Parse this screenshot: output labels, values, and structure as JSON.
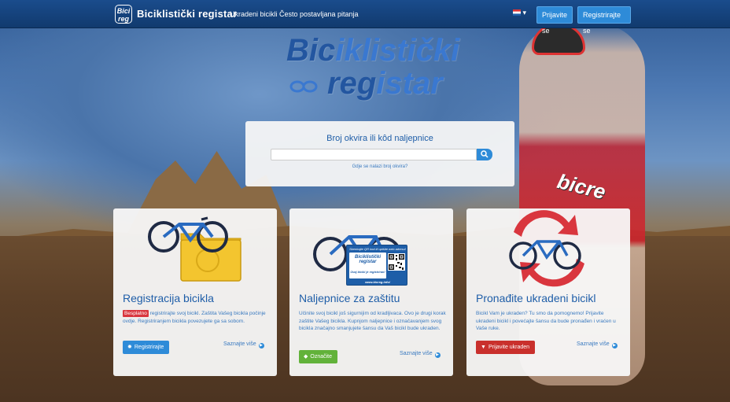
{
  "navbar": {
    "logo_text": "Bici reg",
    "brand": "Biciklistički registar",
    "links": [
      "Ukradeni bicikli",
      "Često postavljana pitanja"
    ],
    "language_selector": "▾",
    "login_label": "Prijavite se",
    "register_label": "Registrirajte se"
  },
  "hero": {
    "title_line1_a": "Bic",
    "title_line1_b": "iklistički",
    "title_line2_a": "reg",
    "title_line2_b": "istar",
    "bike_text": "bicre"
  },
  "search": {
    "label": "Broj okvira ili kôd naljepnice",
    "placeholder": "",
    "help_link": "Gdje se nalazi broj okvira?"
  },
  "cards": [
    {
      "title": "Registracija bicikla",
      "badge": "Besplatno",
      "text": "registrirajte svoj bicikl. Zaštita Vašeg bicikla počinje ovdje. Registriranjem bicikla povezujete ga sa sobom.",
      "button": "Registrirajte",
      "more": "Saznajte više"
    },
    {
      "title": "Naljepnice za zaštitu",
      "text": "Učinite svoj bicikl još sigurnijim od kradljivaca. Ovo je drugi korak zaštite Vašeg bicikla. Kupnjom naljepnice i označavanjem svog bicikla značajno smanjujete šansu da Vaš bicikl bude ukraden.",
      "button": "Označite",
      "more": "Saznajte više",
      "sticker": {
        "top": "Skenirajte QR kod ili upišite web adresu!",
        "brand_l1": "Biciklistički",
        "brand_l2": "registar",
        "sub": "Ovaj bicikl je registriran!",
        "bottom": "www.bicreg.info/"
      }
    },
    {
      "title": "Pronađite ukradeni bicikl",
      "text": "Bicikl Vam je ukraden? Tu smo da pomognemo! Prijavite ukradeni bicikl i povećajte šansu da bude pronađen i vraćen u Vaše ruke.",
      "button": "Prijavite ukraden",
      "more": "Saznajte više"
    }
  ],
  "colors": {
    "nav_bg": "#113a6e",
    "primary": "#2e8bd8",
    "green": "#62b23a",
    "red": "#c9302c",
    "title_blue": "#1f5ea8"
  }
}
